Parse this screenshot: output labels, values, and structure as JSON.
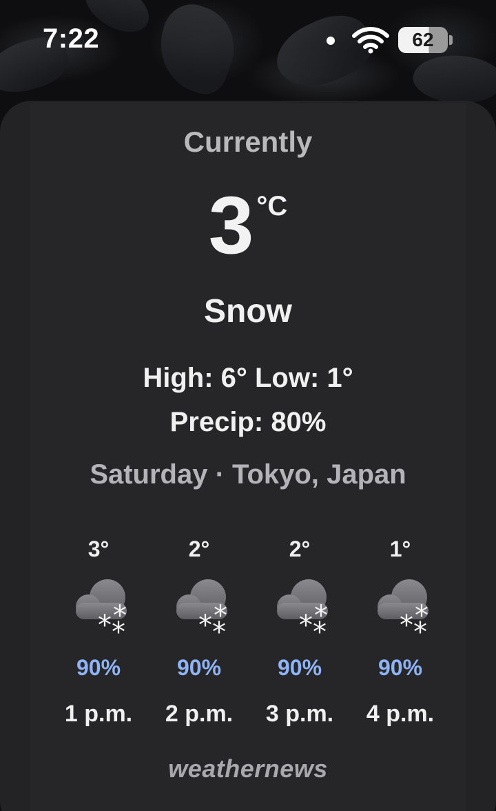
{
  "status_bar": {
    "time": "7:22",
    "battery_level": "62",
    "icons": [
      "notification-dot-icon",
      "wifi-icon",
      "battery-icon"
    ]
  },
  "widget": {
    "title": "Currently",
    "temperature": "3",
    "unit": "°C",
    "condition": "Snow",
    "high_low": "High: 6° Low: 1°",
    "precip": "Precip: 80%",
    "day_location": "Saturday · Tokyo, Japan",
    "hourly": [
      {
        "temp": "3°",
        "icon": "snow-cloud-icon",
        "precip": "90%",
        "time": "1 p.m."
      },
      {
        "temp": "2°",
        "icon": "snow-cloud-icon",
        "precip": "90%",
        "time": "2 p.m."
      },
      {
        "temp": "2°",
        "icon": "snow-cloud-icon",
        "precip": "90%",
        "time": "3 p.m."
      },
      {
        "temp": "1°",
        "icon": "snow-cloud-icon",
        "precip": "90%",
        "time": "4 p.m."
      }
    ],
    "brand": "weathernews"
  },
  "colors": {
    "card_background": "#232325",
    "precip_blue": "#8fb3f7",
    "secondary_text": "#b4b4b8"
  }
}
